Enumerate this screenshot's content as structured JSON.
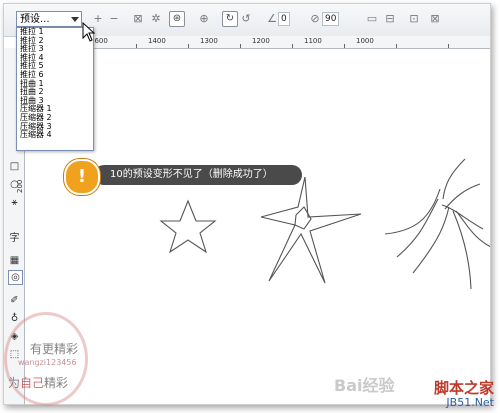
{
  "toolbar": {
    "preset_value": "预设...",
    "plus": "+",
    "minus": "−",
    "angle_value": "0",
    "spin_value": "90"
  },
  "preset_menu": {
    "items": [
      "推拉 1",
      "推拉 2",
      "推拉 3",
      "推拉 4",
      "推拉 5",
      "推拉 6",
      "扭曲 1",
      "扭曲 2",
      "扭曲 3",
      "压缩器 1",
      "压缩器 2",
      "压缩器 3",
      "压缩器 4"
    ]
  },
  "ruler": {
    "h_labels": [
      "1600",
      "1400",
      "1300",
      "1200",
      "1100",
      "1000"
    ],
    "v_labels": [
      "200"
    ]
  },
  "tools": [
    "□",
    "○",
    "⚹",
    "字",
    "▦",
    "◎",
    "✐",
    "♁",
    "◈",
    "⬚"
  ],
  "callout": {
    "badge": "!",
    "text": "10的预设变形不见了（删除成功了）"
  },
  "watermarks": {
    "stamp_top": "有更精彩",
    "stamp_mid": "wangzi123456",
    "stamp_bottom_a": "为",
    "stamp_bottom_b": "自己",
    "stamp_bottom_c": "精彩",
    "baidu": "Bai经验",
    "jb_cn": "脚本之家",
    "jb_url": "JB51.Net"
  },
  "colors": {
    "callout_badge": "#f0a21f",
    "callout_bg": "#4a4a4a",
    "jb_red": "#c0392b",
    "jb_blue": "#2c5fa0"
  }
}
